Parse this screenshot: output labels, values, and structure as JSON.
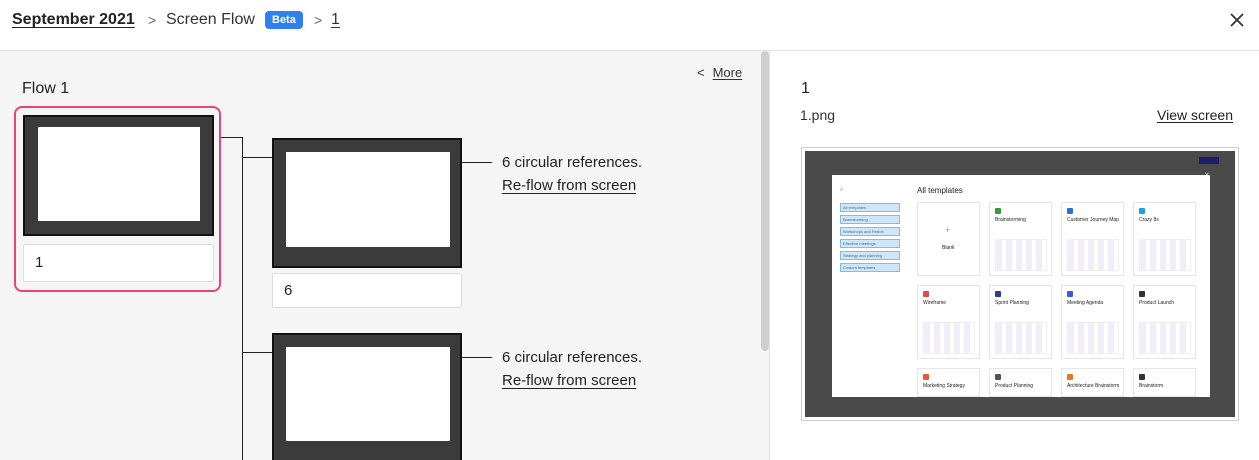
{
  "breadcrumb": {
    "root": "September 2021",
    "sep1": ">",
    "flow": "Screen Flow",
    "badge": "Beta",
    "sep2": ">",
    "current": "1"
  },
  "left": {
    "flow_title": "Flow 1",
    "more_arrow": "<",
    "more_label": "More",
    "nodes": [
      {
        "label": "1"
      },
      {
        "label": "6",
        "refs": "6 circular references.",
        "reflow": "Re-flow from screen"
      },
      {
        "refs": "6 circular references.",
        "reflow": "Re-flow from screen"
      }
    ]
  },
  "right": {
    "title": "1",
    "filename": "1.png",
    "view_screen": "View screen",
    "preview": {
      "modal_title": "All templates",
      "sidebar": [
        "All templates",
        "Brainstorming",
        "Workshops and Retros",
        "Effective meetings",
        "Strategy and planning",
        "Custom templates"
      ],
      "cards": [
        "Blank",
        "Brainstorming",
        "Customer Journey Map",
        "Crazy 8s",
        "Wireframe",
        "Sprint Planning",
        "Meeting Agenda",
        "Product Launch",
        "Marketing Strategy",
        "Product Planning",
        "Architecture Brainstorm",
        "Brainstorm"
      ]
    }
  },
  "colors": {
    "accent": "#2f80ed",
    "selected_border": "#e8437a"
  }
}
